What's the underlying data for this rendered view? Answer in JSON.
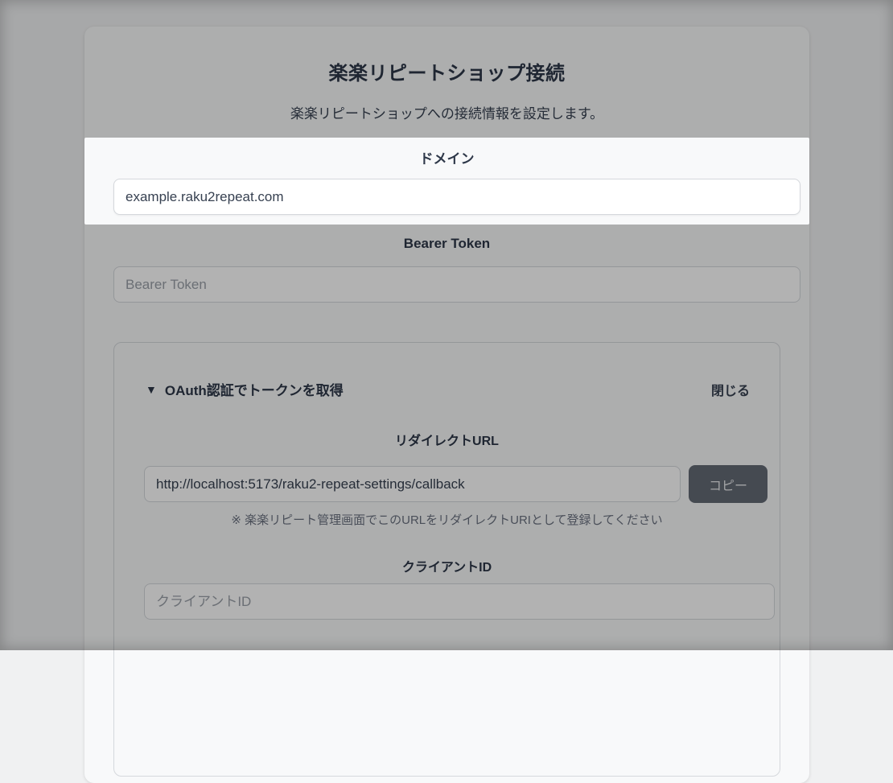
{
  "page": {
    "title": "楽楽リピートショップ接続",
    "subtitle": "楽楽リピートショップへの接続情報を設定します。"
  },
  "fields": {
    "domain": {
      "label": "ドメイン",
      "value": "example.raku2repeat.com"
    },
    "bearer_token": {
      "label": "Bearer Token",
      "placeholder": "Bearer Token"
    }
  },
  "oauth": {
    "toggle_icon": "▼",
    "toggle_label": "OAuth認証でトークンを取得",
    "close_label": "閉じる",
    "redirect_url": {
      "label": "リダイレクトURL",
      "value": "http://localhost:5173/raku2-repeat-settings/callback",
      "copy_label": "コピー"
    },
    "note": "※ 楽楽リピート管理画面でこのURLをリダイレクトURIとして登録してください",
    "client_id": {
      "label": "クライアントID",
      "placeholder": "クライアントID"
    }
  },
  "overlay": {
    "dim_color": "rgba(0,0,0,0.30)",
    "highlighted_section": "ドメイン"
  },
  "colors": {
    "card_background": "#f8f9fa",
    "page_background": "#f0f1f2",
    "heading_text": "#2d3748",
    "input_border": "#d5d8dc",
    "placeholder_text": "#9aa0a8",
    "copy_button_background": "#646a75",
    "note_text": "#6b7280"
  }
}
